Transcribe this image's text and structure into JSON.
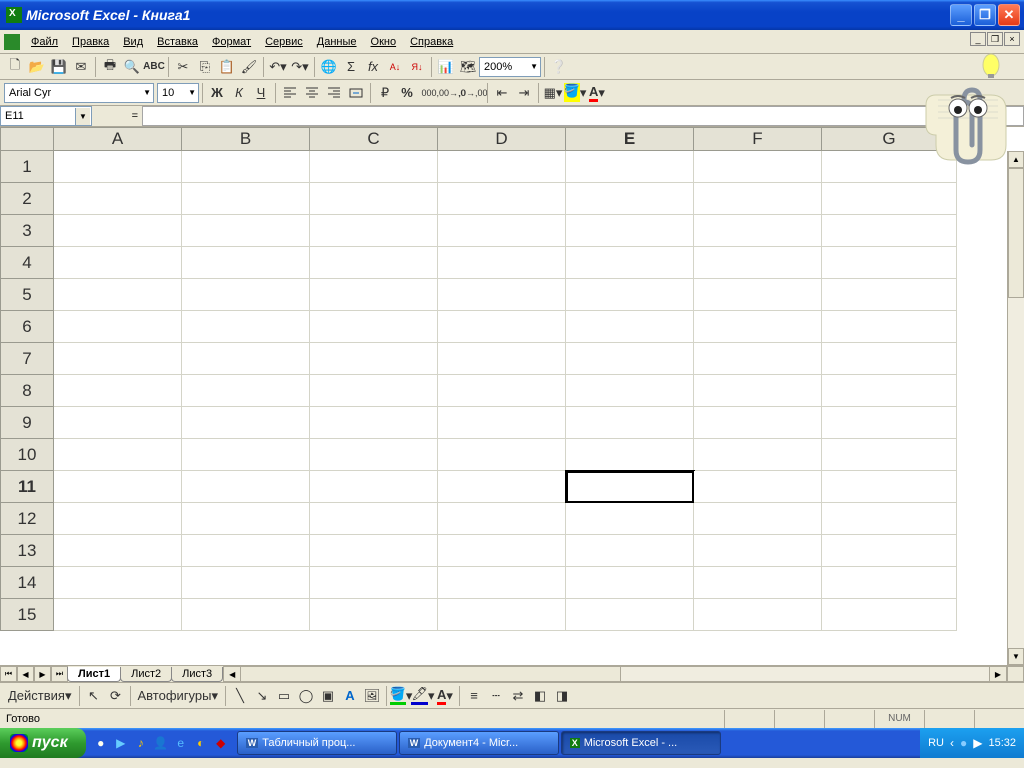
{
  "title": "Microsoft Excel - Книга1",
  "window_controls": {
    "min": "_",
    "max": "❐",
    "close": "✕"
  },
  "menu": [
    "Файл",
    "Правка",
    "Вид",
    "Вставка",
    "Формат",
    "Сервис",
    "Данные",
    "Окно",
    "Справка"
  ],
  "toolbar1": {
    "zoom": "200%"
  },
  "toolbar2": {
    "font": "Arial Cyr",
    "size": "10",
    "bold": "Ж",
    "italic": "К",
    "underline": "Ч",
    "currency": "%",
    "percent": "%",
    "thousands": "000"
  },
  "namebox": "E11",
  "formula_label": "=",
  "columns": [
    "A",
    "B",
    "C",
    "D",
    "E",
    "F",
    "G"
  ],
  "active_col": "E",
  "rows": [
    "1",
    "2",
    "3",
    "4",
    "5",
    "6",
    "7",
    "8",
    "9",
    "10",
    "11",
    "12",
    "13",
    "14",
    "15"
  ],
  "active_row": "11",
  "sheets": [
    "Лист1",
    "Лист2",
    "Лист3"
  ],
  "active_sheet": "Лист1",
  "draw_label": "Действия",
  "autoshapes": "Автофигуры",
  "status": "Готово",
  "status_panels": [
    "",
    "",
    "",
    "NUM",
    "",
    ""
  ],
  "start": "пуск",
  "taskbar": [
    {
      "label": "Табличный проц...",
      "icon": "W"
    },
    {
      "label": "Документ4 - Micr...",
      "icon": "W"
    },
    {
      "label": "Microsoft Excel - ...",
      "icon": "X",
      "active": true
    }
  ],
  "lang": "RU",
  "clock": "15:32"
}
